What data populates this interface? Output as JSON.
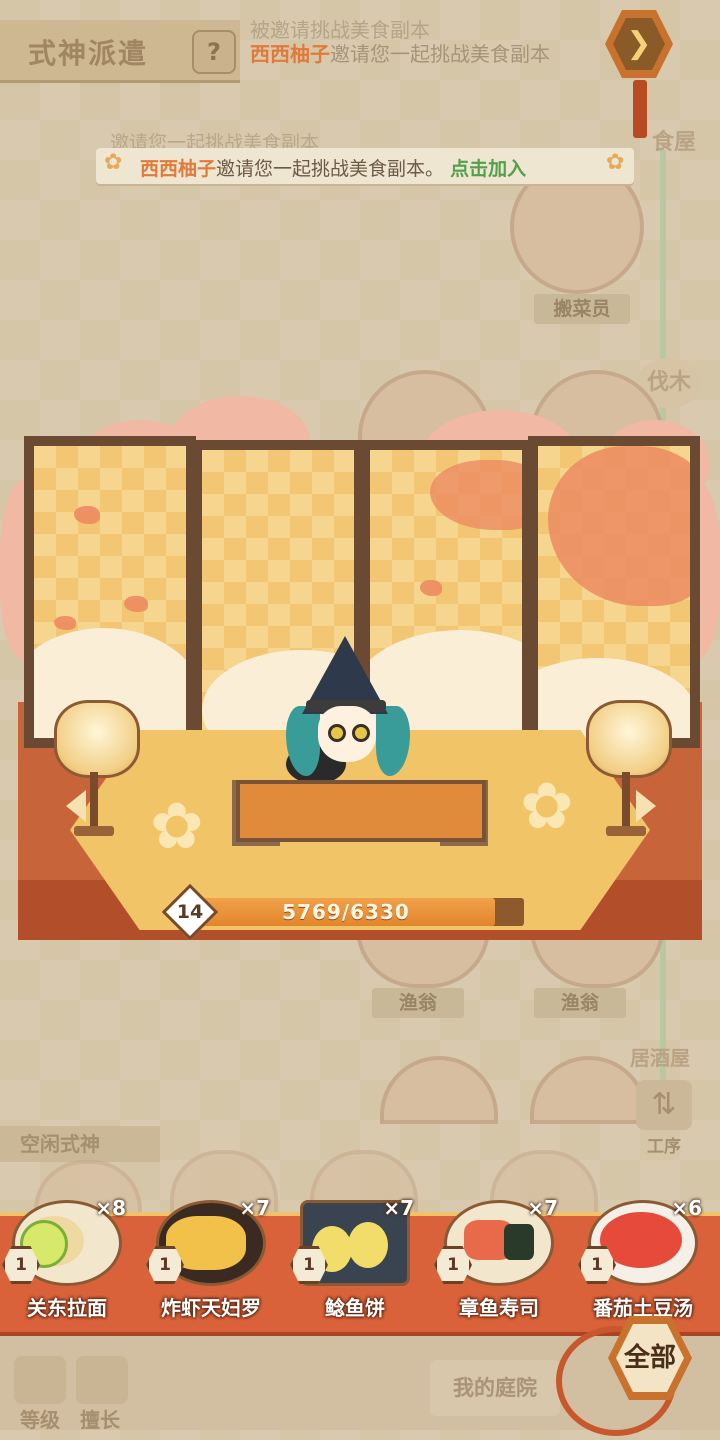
{
  "header": {
    "title": "式神派遣",
    "help_icon": "?",
    "marquee_prev": "被邀请挑战美食副本",
    "marquee_name": "西西柚子",
    "marquee_rest": "邀请您一起挑战美食副本",
    "next_icon": "chevron-right-icon"
  },
  "invite": {
    "prev_line": "邀请您一起挑战美食副本",
    "name": "西西柚子",
    "message": "邀请您一起挑战美食副本。",
    "join": "点击加入"
  },
  "map": {
    "shop_label": "食屋",
    "role_carrier": "搬菜员",
    "lumber_label": "伐木",
    "role_fisher_1": "渔翁",
    "role_fisher_2": "渔翁",
    "tavern_label": "居酒屋"
  },
  "station": {
    "level": "14",
    "progress_text": "5769/6330",
    "progress_value": 5769,
    "progress_max": 6330
  },
  "idle": {
    "label": "空闲式神",
    "sort_icon": "sort-icon",
    "sort_label": "工序"
  },
  "foods": [
    {
      "name": "关东拉面",
      "count": "×8",
      "level": "1",
      "color": "#f0d9a0"
    },
    {
      "name": "炸虾天妇罗",
      "count": "×7",
      "level": "1",
      "color": "#f2c14a"
    },
    {
      "name": "鲶鱼饼",
      "count": "×7",
      "level": "1",
      "color": "#f2dc6a"
    },
    {
      "name": "章鱼寿司",
      "count": "×7",
      "level": "1",
      "color": "#e86a4a"
    },
    {
      "name": "番茄土豆汤",
      "count": "×6",
      "level": "1",
      "color": "#e64a3a"
    }
  ],
  "all_button": "全部",
  "bottom_tabs": {
    "level": "等级",
    "skill": "擅长",
    "courtyard": "我的庭院"
  },
  "colors": {
    "accent": "#e07a3a",
    "join": "#52a04a",
    "tray": "#d9623a"
  }
}
